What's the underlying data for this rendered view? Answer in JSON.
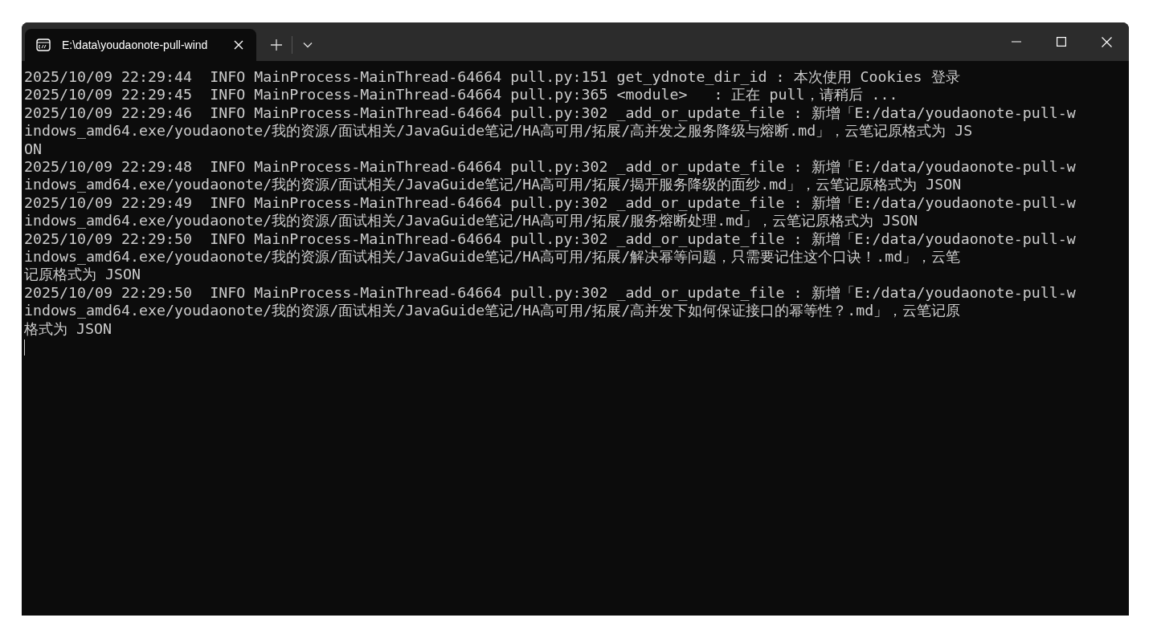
{
  "window": {
    "tab": {
      "title": "E:\\data\\youdaonote-pull-wind",
      "selected": true
    }
  },
  "terminal": {
    "lines": [
      "2025/10/09 22:29:44  INFO MainProcess-MainThread-64664 pull.py:151 get_ydnote_dir_id : 本次使用 Cookies 登录",
      "2025/10/09 22:29:45  INFO MainProcess-MainThread-64664 pull.py:365 <module>   : 正在 pull，请稍后 ...",
      "2025/10/09 22:29:46  INFO MainProcess-MainThread-64664 pull.py:302 _add_or_update_file : 新增「E:/data/youdaonote-pull-w",
      "indows_amd64.exe/youdaonote/我的资源/面试相关/JavaGuide笔记/HA高可用/拓展/高并发之服务降级与熔断.md」，云笔记原格式为 JS",
      "ON",
      "2025/10/09 22:29:48  INFO MainProcess-MainThread-64664 pull.py:302 _add_or_update_file : 新增「E:/data/youdaonote-pull-w",
      "indows_amd64.exe/youdaonote/我的资源/面试相关/JavaGuide笔记/HA高可用/拓展/揭开服务降级的面纱.md」，云笔记原格式为 JSON",
      "2025/10/09 22:29:49  INFO MainProcess-MainThread-64664 pull.py:302 _add_or_update_file : 新增「E:/data/youdaonote-pull-w",
      "indows_amd64.exe/youdaonote/我的资源/面试相关/JavaGuide笔记/HA高可用/拓展/服务熔断处理.md」，云笔记原格式为 JSON",
      "2025/10/09 22:29:50  INFO MainProcess-MainThread-64664 pull.py:302 _add_or_update_file : 新增「E:/data/youdaonote-pull-w",
      "indows_amd64.exe/youdaonote/我的资源/面试相关/JavaGuide笔记/HA高可用/拓展/解决幂等问题，只需要记住这个口诀！.md」，云笔",
      "记原格式为 JSON",
      "2025/10/09 22:29:50  INFO MainProcess-MainThread-64664 pull.py:302 _add_or_update_file : 新增「E:/data/youdaonote-pull-w",
      "indows_amd64.exe/youdaonote/我的资源/面试相关/JavaGuide笔记/HA高可用/拓展/高并发下如何保证接口的幂等性？.md」，云笔记原",
      "格式为 JSON"
    ]
  }
}
